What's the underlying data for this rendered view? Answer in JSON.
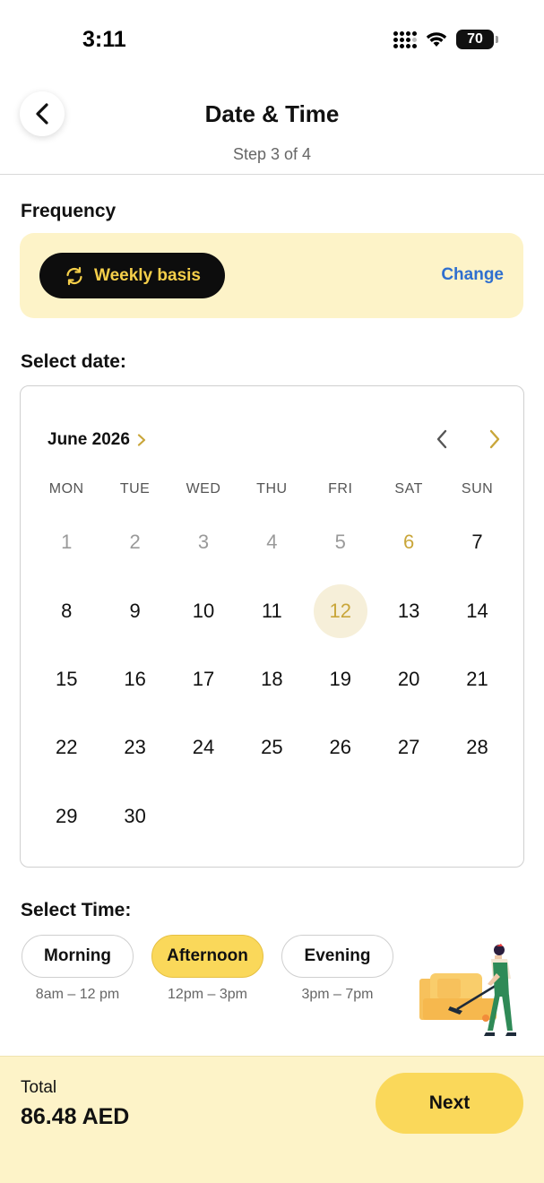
{
  "status": {
    "time": "3:11",
    "battery": "70"
  },
  "header": {
    "title": "Date & Time",
    "step": "Step 3 of 4"
  },
  "frequency": {
    "label": "Frequency",
    "value": "Weekly basis",
    "change": "Change"
  },
  "date_section": {
    "label": "Select date:"
  },
  "calendar": {
    "month": "June 2026",
    "weekdays": [
      "MON",
      "TUE",
      "WED",
      "THU",
      "FRI",
      "SAT",
      "SUN"
    ],
    "days": [
      "1",
      "2",
      "3",
      "4",
      "5",
      "6",
      "7",
      "8",
      "9",
      "10",
      "11",
      "12",
      "13",
      "14",
      "15",
      "16",
      "17",
      "18",
      "19",
      "20",
      "21",
      "22",
      "23",
      "24",
      "25",
      "26",
      "27",
      "28",
      "29",
      "30"
    ],
    "past_days": [
      "1",
      "2",
      "3",
      "4",
      "5"
    ],
    "today": "6",
    "selected": "12"
  },
  "time_section": {
    "label": "Select Time:",
    "options": [
      {
        "label": "Morning",
        "range": "8am – 12 pm"
      },
      {
        "label": "Afternoon",
        "range": "12pm – 3pm"
      },
      {
        "label": "Evening",
        "range": "3pm – 7pm"
      }
    ],
    "selected": "Afternoon"
  },
  "footer": {
    "total_label": "Total",
    "total_value": "86.48 AED",
    "next": "Next"
  },
  "colors": {
    "accent_yellow": "#fad85a",
    "cream": "#fdf3c8",
    "gold_text": "#c9a63a",
    "link_blue": "#2f6fcf"
  }
}
